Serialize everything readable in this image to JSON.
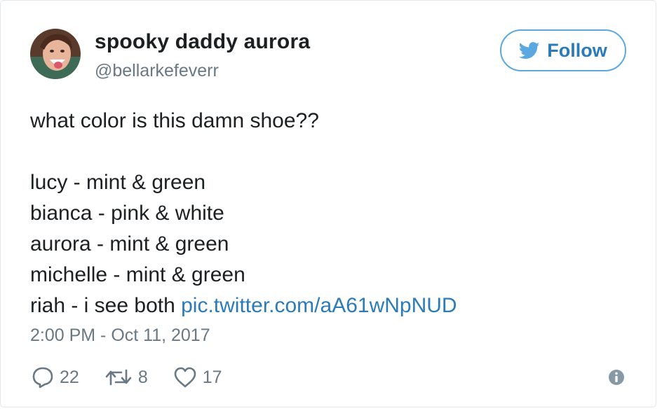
{
  "user": {
    "display_name": "spooky daddy aurora",
    "handle": "@bellarkefeverr",
    "avatar_icon": "profile-photo"
  },
  "follow_button": {
    "label": "Follow",
    "icon": "twitter-bird-icon"
  },
  "tweet": {
    "line1": "what color is this damn shoe??",
    "line2": "lucy - mint & green",
    "line3": "bianca - pink & white",
    "line4": "aurora - mint & green",
    "line5": "michelle - mint & green",
    "line6_text": "riah - i see both ",
    "link": "pic.twitter.com/aA61wNpNUD"
  },
  "timestamp": "2:00 PM - Oct 11, 2017",
  "actions": {
    "replies": "22",
    "retweets": "8",
    "likes": "17"
  },
  "colors": {
    "link": "#2b7bb9",
    "follow_border": "#5aa8df",
    "muted": "#697882",
    "text": "#1c2022"
  }
}
